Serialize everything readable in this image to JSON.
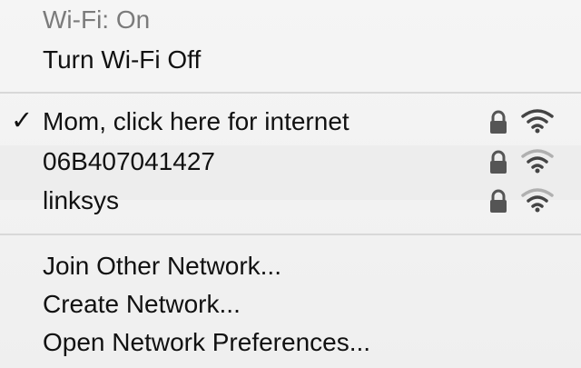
{
  "wifi_status": "Wi-Fi: On",
  "toggle_label": "Turn Wi-Fi Off",
  "networks": [
    {
      "name": "Mom, click here for internet",
      "selected": true,
      "secured": true,
      "signal_bars": 3
    },
    {
      "name": "06B407041427",
      "selected": false,
      "secured": true,
      "signal_bars": 2
    },
    {
      "name": "linksys",
      "selected": false,
      "secured": true,
      "signal_bars": 2
    }
  ],
  "actions": [
    {
      "label": "Join Other Network..."
    },
    {
      "label": "Create Network..."
    },
    {
      "label": "Open Network Preferences..."
    }
  ],
  "icons": {
    "selected": "checkmark-icon",
    "secured": "lock-icon",
    "signal": "wifi-signal-icon"
  },
  "colors": {
    "menu_background": "#f3f3f3",
    "text": "#111111",
    "disabled_text": "#7b7b7b",
    "separator": "#d8d8d8",
    "signal_active": "#444444",
    "signal_inactive": "#b0b0b0"
  }
}
